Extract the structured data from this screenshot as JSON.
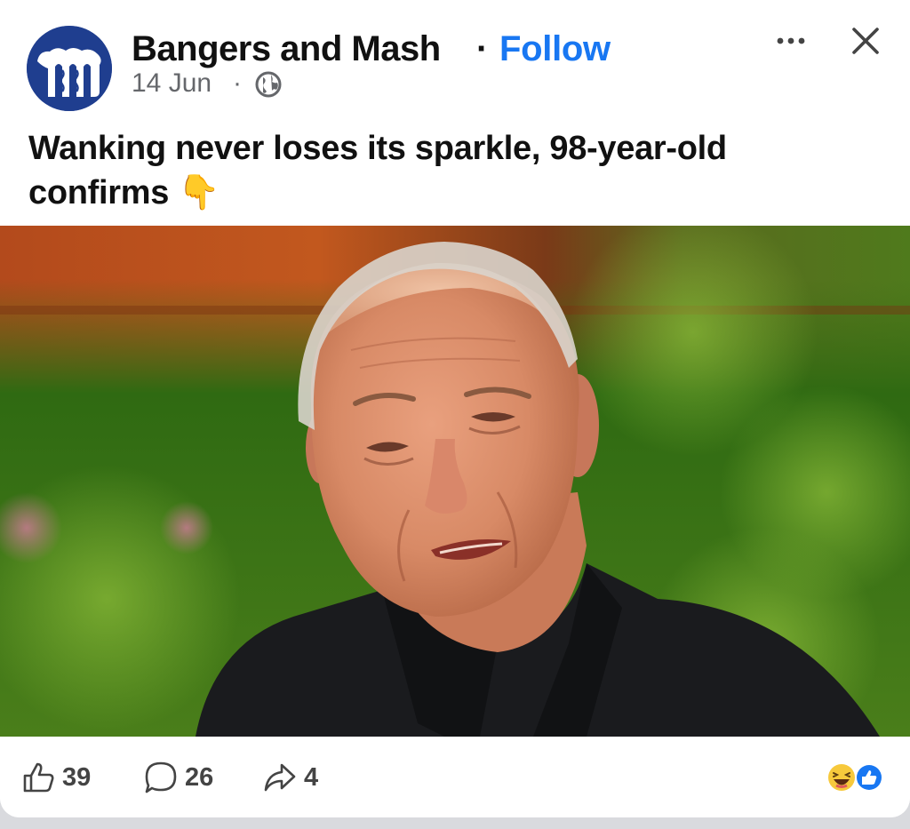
{
  "post": {
    "page_name": "Bangers and Mash",
    "separator": "·",
    "follow_label": "Follow",
    "date": "14 Jun",
    "date_separator": "·",
    "privacy_icon": "globe-icon",
    "text": "Wanking never loses its sparkle, 98-year-old confirms 👇",
    "menu_icon": "more-options-icon",
    "close_icon": "close-icon"
  },
  "footer": {
    "likes": "39",
    "comments": "26",
    "shares": "4",
    "reactions": [
      "haha-reaction-icon",
      "like-reaction-icon"
    ]
  },
  "colors": {
    "follow": "#1877f2",
    "avatar": "#1f3e8f",
    "secondary_text": "#65676b"
  }
}
